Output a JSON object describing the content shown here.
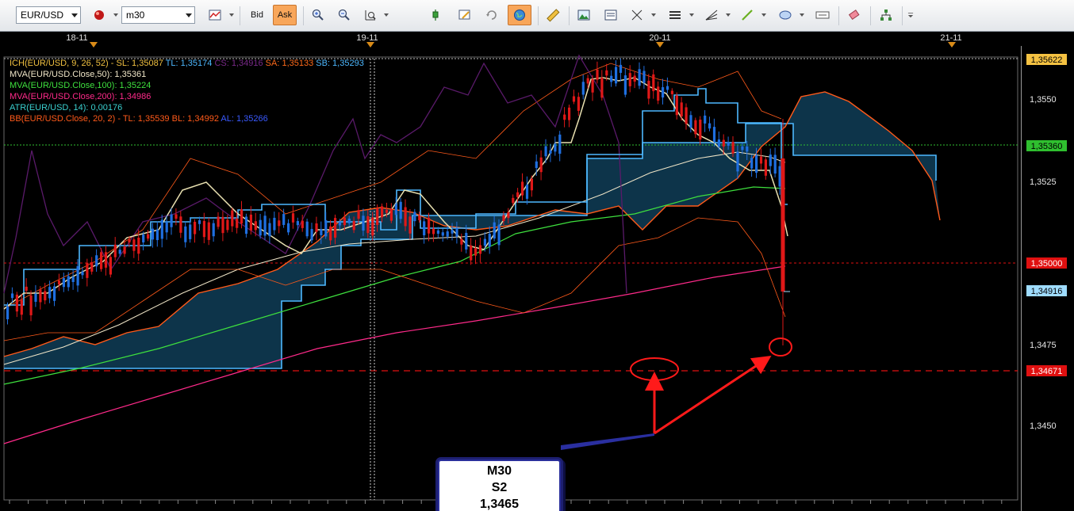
{
  "toolbar": {
    "symbol": "EUR/USD",
    "timeframe": "m30",
    "bid_label": "Bid",
    "ask_label": "Ask",
    "tools": [
      "line-chart-icon",
      "zoom-in-icon",
      "zoom-out-icon",
      "chart-scale-icon",
      "indicator-icon",
      "edit-chart-icon",
      "refresh-icon",
      "globe-icon",
      "ruler-icon",
      "image-icon",
      "template-icon",
      "crosshair-icon",
      "horizontal-lines-icon",
      "fan-icon",
      "trendline-icon",
      "ellipse-icon",
      "text-label-icon",
      "eraser-icon",
      "hierarchy-icon"
    ]
  },
  "time_axis": {
    "labels": [
      "18-11",
      "19-11",
      "20-11",
      "21-11"
    ]
  },
  "price_axis": {
    "ticks": [
      "1,3550",
      "1,3525",
      "1,3475",
      "1,3450"
    ],
    "tags": [
      {
        "value": "1,35622",
        "bg": "#f5c242",
        "fg": "#000000"
      },
      {
        "value": "1,35360",
        "bg": "#2fbf2f",
        "fg": "#000000"
      },
      {
        "value": "1,35000",
        "bg": "#e01010",
        "fg": "#ffffff"
      },
      {
        "value": "1,34916",
        "bg": "#9fdcff",
        "fg": "#000000"
      },
      {
        "value": "1,34671",
        "bg": "#e01010",
        "fg": "#ffffff"
      }
    ]
  },
  "legend": [
    {
      "parts": [
        {
          "text": "ICH(EUR/USD, 9, 26, 52) -  SL: 1,35087",
          "color": "#f0c040"
        },
        {
          "text": "  TL: 1,35174",
          "color": "#4db8ff"
        },
        {
          "text": "  CS: 1,34916",
          "color": "#7a2a8a"
        },
        {
          "text": "  SA: 1,35133",
          "color": "#ff6a1a"
        },
        {
          "text": "  SB: 1,35293",
          "color": "#4db8ff"
        }
      ]
    },
    {
      "parts": [
        {
          "text": "MVA(EUR/USD.Close,50): 1,35361",
          "color": "#f0e6c8"
        }
      ]
    },
    {
      "parts": [
        {
          "text": "MVA(EUR/USD.Close,100): 1,35224",
          "color": "#3ee03e"
        }
      ]
    },
    {
      "parts": [
        {
          "text": "MVA(EUR/USD.Close,200): 1,34986",
          "color": "#ff2a8a"
        }
      ]
    },
    {
      "parts": [
        {
          "text": "ATR(EUR/USD, 14): 0,00176",
          "color": "#3ad0d0"
        }
      ]
    },
    {
      "parts": [
        {
          "text": "BB(EUR/USD.Close, 20, 2) -  TL: 1,35539",
          "color": "#ff5a1a"
        },
        {
          "text": "  BL: 1,34992",
          "color": "#ff5a1a"
        },
        {
          "text": "  AL: 1,35266",
          "color": "#3a5aff"
        }
      ]
    }
  ],
  "annotation": {
    "line1": "M30",
    "line2": "S2",
    "line3": "1,3465"
  },
  "colors": {
    "bull_candle": "#1f6fe0",
    "bear_candle": "#e01818",
    "tenkan": "#4db8ff",
    "kijun": "#e8e0b0",
    "cloud_fill": "#0e3a52",
    "bb": "#ff5a1a",
    "chikou": "#5a1a6a",
    "ma100": "#3ee03e",
    "ma200": "#ff2a8a"
  }
}
